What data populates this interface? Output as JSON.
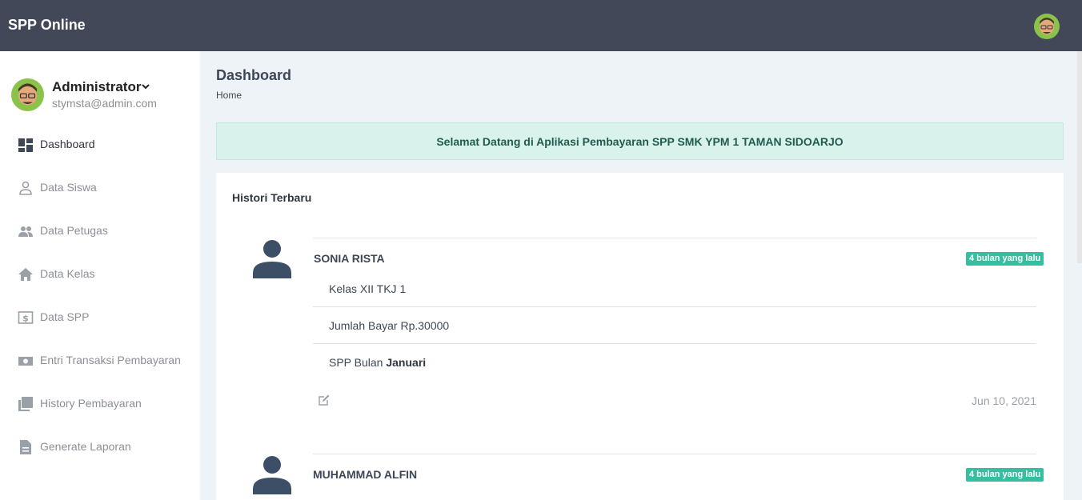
{
  "app": {
    "brand": "SPP Online"
  },
  "sidebar": {
    "profile": {
      "name": "Administrator",
      "email": "stymsta@admin.com"
    },
    "items": [
      {
        "label": "Dashboard",
        "icon": "dashboard-icon",
        "active": true
      },
      {
        "label": "Data Siswa",
        "icon": "person-icon"
      },
      {
        "label": "Data Petugas",
        "icon": "people-icon"
      },
      {
        "label": "Data Kelas",
        "icon": "home-icon"
      },
      {
        "label": "Data SPP",
        "icon": "money-icon"
      },
      {
        "label": "Entri Transaksi Pembayaran",
        "icon": "cash-icon"
      },
      {
        "label": "History Pembayaran",
        "icon": "library-icon"
      },
      {
        "label": "Generate Laporan",
        "icon": "document-icon"
      }
    ]
  },
  "main": {
    "title": "Dashboard",
    "breadcrumb": "Home",
    "welcome": "Selamat Datang di Aplikasi Pembayaran SPP SMK YPM 1 TAMAN SIDOARJO",
    "history": {
      "title": "Histori Terbaru",
      "entries": [
        {
          "name": "SONIA RISTA",
          "badge": "4 bulan yang lalu",
          "kelas": "Kelas XII TKJ 1",
          "jumlah": "Jumlah Bayar Rp.30000",
          "spp_prefix": "SPP Bulan",
          "spp_bulan": "Januari",
          "date": "Jun 10, 2021"
        },
        {
          "name": "MUHAMMAD ALFIN",
          "badge": "4 bulan yang lalu"
        }
      ]
    }
  },
  "colors": {
    "topbar": "#424857",
    "badge": "#35bfa0",
    "welcome_bg": "#d9f2ec"
  }
}
